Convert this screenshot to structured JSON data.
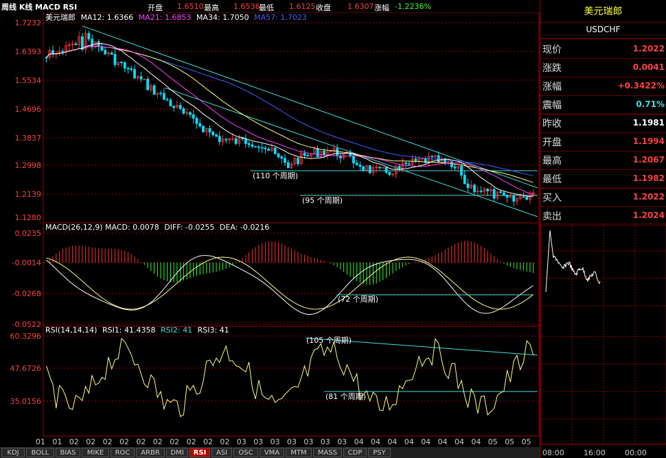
{
  "title": "周线 K线 MACD RSI",
  "ohlc": {
    "open_label": "开盘",
    "open_value": "1.6510",
    "high_label": "最高",
    "high_value": "1.6536",
    "low_label": "最低",
    "low_value": "1.6125",
    "close_label": "收盘",
    "close_value": "1.6307",
    "change_label": "涨幅",
    "change_value": "-1.2236%"
  },
  "ma_legend": {
    "symbol": "美元瑞郎",
    "ma12": "MA12: 1.6366",
    "ma21": "MA21: 1.6853",
    "ma34": "MA34: 1.7050",
    "ma57": "MA57: 1.7023"
  },
  "price_axis": [
    "1.7232",
    "1.6393",
    "1.5534",
    "1.4696",
    "1.3837",
    "1.2998",
    "1.2139",
    "1.1280"
  ],
  "price_annotations": [
    "(110 个周期)",
    "(95 个周期)"
  ],
  "macd": {
    "legend": "MACD(26,12,9) MACD: 0.0078",
    "diff": "DIFF: -0.0255",
    "dea": "DEA: -0.0216",
    "axis": [
      "0.0235",
      "-0.0014",
      "-0.0268",
      "-0.0522"
    ],
    "annotation": "(72 个周期)"
  },
  "rsi": {
    "legend": "RSI(14,14,14)",
    "rsi1": "RSI1: 41.4358",
    "rsi2": "RSI2: 41",
    "rsi3": "RSI3: 41",
    "axis": [
      "60.3296",
      "47.6726",
      "35.0156"
    ],
    "annotations": [
      "(105 个周期)",
      "(81 个周期)"
    ]
  },
  "x_axis": [
    "01",
    "01",
    "02",
    "02",
    "02",
    "02",
    "02",
    "02",
    "02",
    "02",
    "02",
    "02",
    "03",
    "03",
    "03",
    "03",
    "03",
    "03",
    "03",
    "04",
    "04",
    "04",
    "04",
    "04",
    "04",
    "04",
    "04",
    "05",
    "05",
    "05"
  ],
  "quote": {
    "name": "美元瑞郎",
    "code": "USDCHF",
    "rows": [
      {
        "label": "现价",
        "value": "1.2022",
        "color": "#ff4040"
      },
      {
        "label": "涨跌",
        "value": "0.0041",
        "color": "#ff4040"
      },
      {
        "label": "涨幅",
        "value": "+0.3422%",
        "color": "#ff4040"
      },
      {
        "label": "震幅",
        "value": "0.71%",
        "color": "#40e0e0"
      },
      {
        "label": "昨收",
        "value": "1.1981",
        "color": "#ffffff"
      },
      {
        "label": "开盘",
        "value": "1.1994",
        "color": "#ff4040"
      },
      {
        "label": "最高",
        "value": "1.2067",
        "color": "#ff4040"
      },
      {
        "label": "最低",
        "value": "1.1982",
        "color": "#ff4040"
      },
      {
        "label": "买入",
        "value": "1.2022",
        "color": "#ff4040"
      },
      {
        "label": "卖出",
        "value": "1.2024",
        "color": "#ff4040"
      }
    ]
  },
  "intraday_axis": [
    "08:00",
    "16:00",
    "00:00"
  ],
  "tabs": [
    "KDJ",
    "BOLL",
    "BIAS",
    "MIKE",
    "ROC",
    "ARBR",
    "DMI",
    "RSI",
    "ASI",
    "OSC",
    "VMA",
    "MTM",
    "MASS",
    "CDP",
    "PSY"
  ],
  "active_tab": "RSI",
  "colors": {
    "up": "#ff3030",
    "down": "#00e0ff",
    "ma12": "#ffffff",
    "ma21": "#ff40ff",
    "ma34": "#ffff80",
    "ma57": "#4060ff",
    "trend": "#40e0e0",
    "grid": "#a00000",
    "rsi": "#ffff80"
  }
}
